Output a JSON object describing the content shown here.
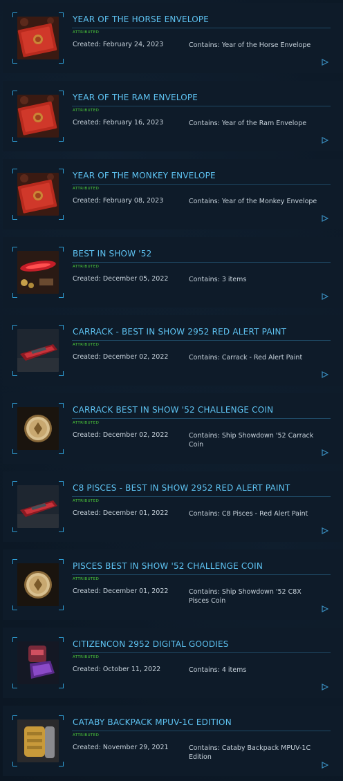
{
  "status_label": "ATTRIBUTED",
  "created_prefix": "Created: ",
  "contains_prefix": "Contains: ",
  "items": [
    {
      "title": "YEAR OF THE HORSE ENVELOPE",
      "created": "Created: February 24, 2023",
      "contains": "Contains: Year of the Horse Envelope",
      "thumb": "envelope-icon"
    },
    {
      "title": "YEAR OF THE RAM ENVELOPE",
      "created": "Created: February 16, 2023",
      "contains": "Contains: Year of the Ram Envelope",
      "thumb": "envelope-icon"
    },
    {
      "title": "YEAR OF THE MONKEY ENVELOPE",
      "created": "Created: February 08, 2023",
      "contains": "Contains: Year of the Monkey Envelope",
      "thumb": "envelope-icon"
    },
    {
      "title": "BEST IN SHOW '52",
      "created": "Created: December 05, 2022",
      "contains": "Contains: 3 items",
      "thumb": "ship-collection-icon"
    },
    {
      "title": "CARRACK - BEST IN SHOW 2952 RED ALERT PAINT",
      "created": "Created: December 02, 2022",
      "contains": "Contains: Carrack - Red Alert Paint",
      "thumb": "ship-icon"
    },
    {
      "title": "CARRACK BEST IN SHOW '52 CHALLENGE COIN",
      "created": "Created: December 02, 2022",
      "contains": "Contains: Ship Showdown '52 Carrack Coin",
      "thumb": "coin-icon"
    },
    {
      "title": "C8 PISCES - BEST IN SHOW 2952 RED ALERT PAINT",
      "created": "Created: December 01, 2022",
      "contains": "Contains: C8 Pisces - Red Alert Paint",
      "thumb": "ship-icon"
    },
    {
      "title": "PISCES BEST IN SHOW '52 CHALLENGE COIN",
      "created": "Created: December 01, 2022",
      "contains": "Contains: Ship Showdown '52 C8X Pisces Coin",
      "thumb": "coin-icon"
    },
    {
      "title": "CITIZENCON 2952 DIGITAL GOODIES",
      "created": "Created: October 11, 2022",
      "contains": "Contains: 4 items",
      "thumb": "armor-icon"
    },
    {
      "title": "CATABY BACKPACK MPUV-1C EDITION",
      "created": "Created: November 29, 2021",
      "contains": "Contains: Cataby Backpack MPUV-1C Edition",
      "thumb": "backpack-icon"
    }
  ],
  "colors": {
    "title": "#5ec3f2",
    "status": "#4ecf3a",
    "text": "#c8d3dc",
    "accent": "#2f9fd6",
    "card": "#0e1b29"
  }
}
